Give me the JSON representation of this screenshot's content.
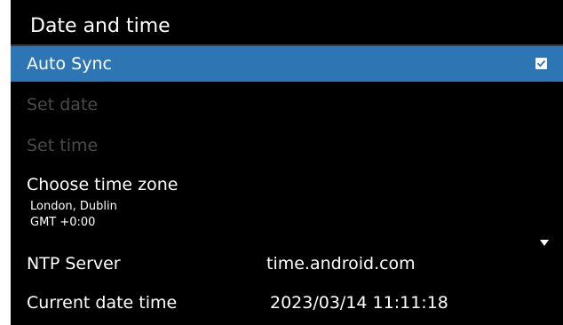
{
  "header": {
    "title": "Date and time"
  },
  "settings": {
    "auto_sync": {
      "label": "Auto Sync",
      "checked": true,
      "check_icon": "checkbox-checked-icon"
    },
    "set_date": {
      "label": "Set date",
      "enabled": false
    },
    "set_time": {
      "label": "Set time",
      "enabled": false
    },
    "time_zone": {
      "label": "Choose time zone",
      "city": "London, Dublin",
      "offset": "GMT +0:00",
      "expand_icon": "caret-down-icon"
    },
    "ntp_server": {
      "label": "NTP Server",
      "value": "time.android.com"
    },
    "current_date_time": {
      "label": "Current date time",
      "value": "2023/03/14 11:11:18"
    }
  },
  "colors": {
    "background": "#000000",
    "selected_row": "#2d76b3",
    "disabled_text": "#4a4a4a",
    "text": "#ffffff"
  }
}
